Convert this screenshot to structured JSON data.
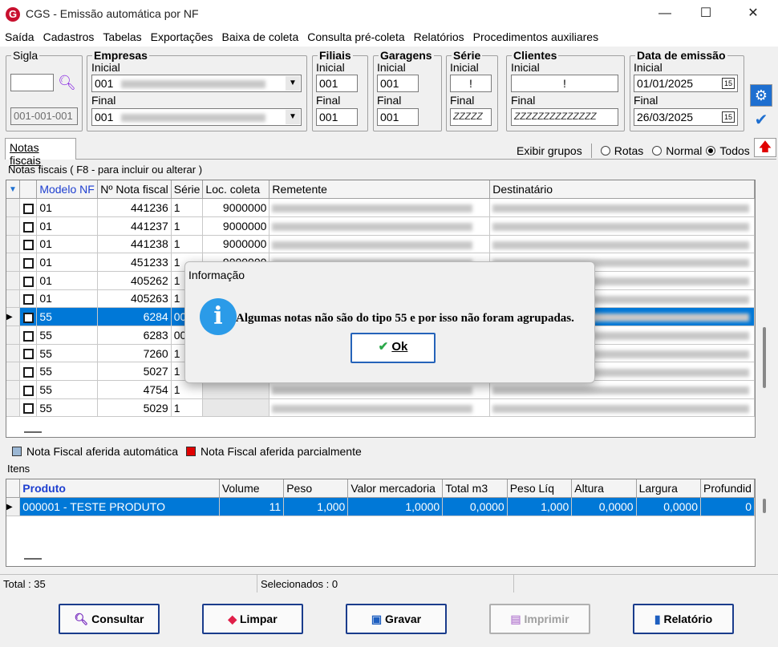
{
  "window": {
    "title": "CGS - Emissão automática por NF",
    "minimize": "—",
    "maximize": "☐",
    "close": "✕"
  },
  "menu": [
    "Saída",
    "Cadastros",
    "Tabelas",
    "Exportações",
    "Baixa de coleta",
    "Consulta pré-coleta",
    "Relatórios",
    "Procedimentos auxiliares"
  ],
  "filters": {
    "sigla": {
      "legend": "Sigla",
      "value": "",
      "code": "001-001-001"
    },
    "empresas": {
      "legend": "Empresas",
      "inicial_label": "Inicial",
      "inicial_value": "001",
      "final_label": "Final",
      "final_value": "001"
    },
    "filiais": {
      "legend": "Filiais",
      "inicial_label": "Inicial",
      "inicial_value": "001",
      "final_label": "Final",
      "final_value": "001"
    },
    "garagens": {
      "legend": "Garagens",
      "inicial_label": "Inicial",
      "inicial_value": "001",
      "final_label": "Final",
      "final_value": "001"
    },
    "serie": {
      "legend": "Série",
      "inicial_label": "Inicial",
      "inicial_value": "!",
      "final_label": "Final",
      "final_value": "ZZZZZ"
    },
    "clientes": {
      "legend": "Clientes",
      "inicial_label": "Inicial",
      "inicial_value": "!",
      "final_label": "Final",
      "final_value": "ZZZZZZZZZZZZZZ"
    },
    "data_emissao": {
      "legend": "Data de emissão",
      "inicial_label": "Inicial",
      "inicial_value": "01/01/2025",
      "final_label": "Final",
      "final_value": "26/03/2025",
      "cal": "15"
    }
  },
  "tab": {
    "label": "Notas fiscais"
  },
  "group_options": {
    "label": "Exibir grupos",
    "options": [
      "Rotas",
      "Normal",
      "Todos"
    ],
    "selected": "Todos"
  },
  "notas": {
    "caption": "Notas fiscais ( F8 - para incluir ou alterar )",
    "columns": [
      "Modelo NF",
      "Nº Nota fiscal",
      "Série",
      "Loc. coleta",
      "Remetente",
      "Destinatário"
    ],
    "rows": [
      {
        "modelo": "01",
        "nota": "441236",
        "serie": "1",
        "loc": "9000000"
      },
      {
        "modelo": "01",
        "nota": "441237",
        "serie": "1",
        "loc": "9000000"
      },
      {
        "modelo": "01",
        "nota": "441238",
        "serie": "1",
        "loc": "9000000"
      },
      {
        "modelo": "01",
        "nota": "451233",
        "serie": "1",
        "loc": "9000000"
      },
      {
        "modelo": "01",
        "nota": "405262",
        "serie": "1",
        "loc": ""
      },
      {
        "modelo": "01",
        "nota": "405263",
        "serie": "1",
        "loc": ""
      },
      {
        "modelo": "55",
        "nota": "6284",
        "serie": "00",
        "loc": ""
      },
      {
        "modelo": "55",
        "nota": "6283",
        "serie": "00",
        "loc": ""
      },
      {
        "modelo": "55",
        "nota": "7260",
        "serie": "1",
        "loc": ""
      },
      {
        "modelo": "55",
        "nota": "5027",
        "serie": "1",
        "loc": ""
      },
      {
        "modelo": "55",
        "nota": "4754",
        "serie": "1",
        "loc": ""
      },
      {
        "modelo": "55",
        "nota": "5029",
        "serie": "1",
        "loc": ""
      }
    ],
    "selected_row": 6
  },
  "legend_items": {
    "auto": "Nota Fiscal aferida automática",
    "partial": "Nota Fiscal aferida parcialmente"
  },
  "colors": {
    "auto": "#9bb7d4",
    "partial": "#e00000",
    "accent": "#0078d7"
  },
  "itens": {
    "caption": "Itens",
    "columns": [
      "Produto",
      "Volume",
      "Peso",
      "Valor mercadoria",
      "Total m3",
      "Peso Líq",
      "Altura",
      "Largura",
      "Profundid"
    ],
    "row": [
      "000001 - TESTE PRODUTO",
      "11",
      "1,000",
      "1,0000",
      "0,0000",
      "1,000",
      "0,0000",
      "0,0000",
      "0"
    ]
  },
  "status": {
    "total": "Total : 35",
    "selecionados": "Selecionados : 0"
  },
  "buttons": {
    "consultar": "Consultar",
    "limpar": "Limpar",
    "gravar": "Gravar",
    "imprimir": "Imprimir",
    "relatorio": "Relatório"
  },
  "dialog": {
    "title": "Informação",
    "message": "Algumas notas não são do tipo 55 e por isso não foram agrupadas.",
    "ok": "Ok",
    "icon": "i"
  }
}
